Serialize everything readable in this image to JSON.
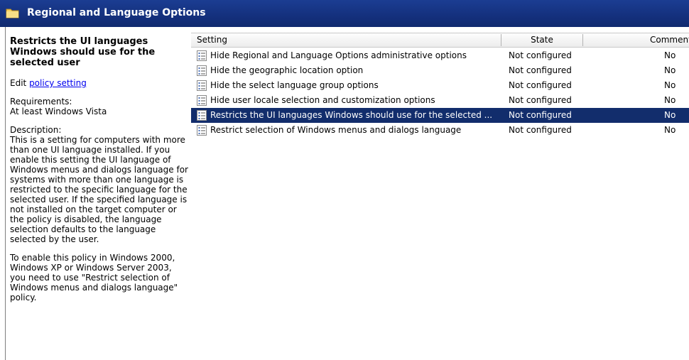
{
  "window": {
    "title": "Regional and Language Options"
  },
  "details": {
    "title": "Restricts the UI languages Windows should use for the selected user",
    "edit_prefix": "Edit ",
    "edit_link": "policy setting",
    "requirements_label": "Requirements:",
    "requirements_value": "At least Windows Vista",
    "description_label": "Description:",
    "description_text": "This is a setting for computers with more than one UI language installed. If you enable this setting the UI language of Windows menus and dialogs language for systems with more than one language is restricted to the specific language for the selected user. If the specified language is not installed on the target computer or the policy is disabled, the language selection defaults to the language selected by the user.",
    "note_text": "To enable this policy in Windows 2000, Windows XP or Windows Server 2003, you need to use \"Restrict selection of Windows menus and dialogs language\" policy."
  },
  "table": {
    "columns": [
      "Setting",
      "State",
      "Comment"
    ],
    "rows": [
      {
        "setting": "Hide Regional and Language Options administrative options",
        "state": "Not configured",
        "comment": "No",
        "selected": false
      },
      {
        "setting": "Hide the geographic location option",
        "state": "Not configured",
        "comment": "No",
        "selected": false
      },
      {
        "setting": "Hide the select language group options",
        "state": "Not configured",
        "comment": "No",
        "selected": false
      },
      {
        "setting": "Hide user locale selection and customization options",
        "state": "Not configured",
        "comment": "No",
        "selected": false
      },
      {
        "setting": "Restricts the UI languages Windows should use for the selected ...",
        "state": "Not configured",
        "comment": "No",
        "selected": true
      },
      {
        "setting": "Restrict selection of Windows menus and dialogs language",
        "state": "Not configured",
        "comment": "No",
        "selected": false
      }
    ]
  },
  "icons": {
    "banner": "folder-icon",
    "row": "policy-setting-icon"
  },
  "colors": {
    "banner": "#14307d",
    "selection": "#122d6c",
    "link": "#0000ee"
  }
}
